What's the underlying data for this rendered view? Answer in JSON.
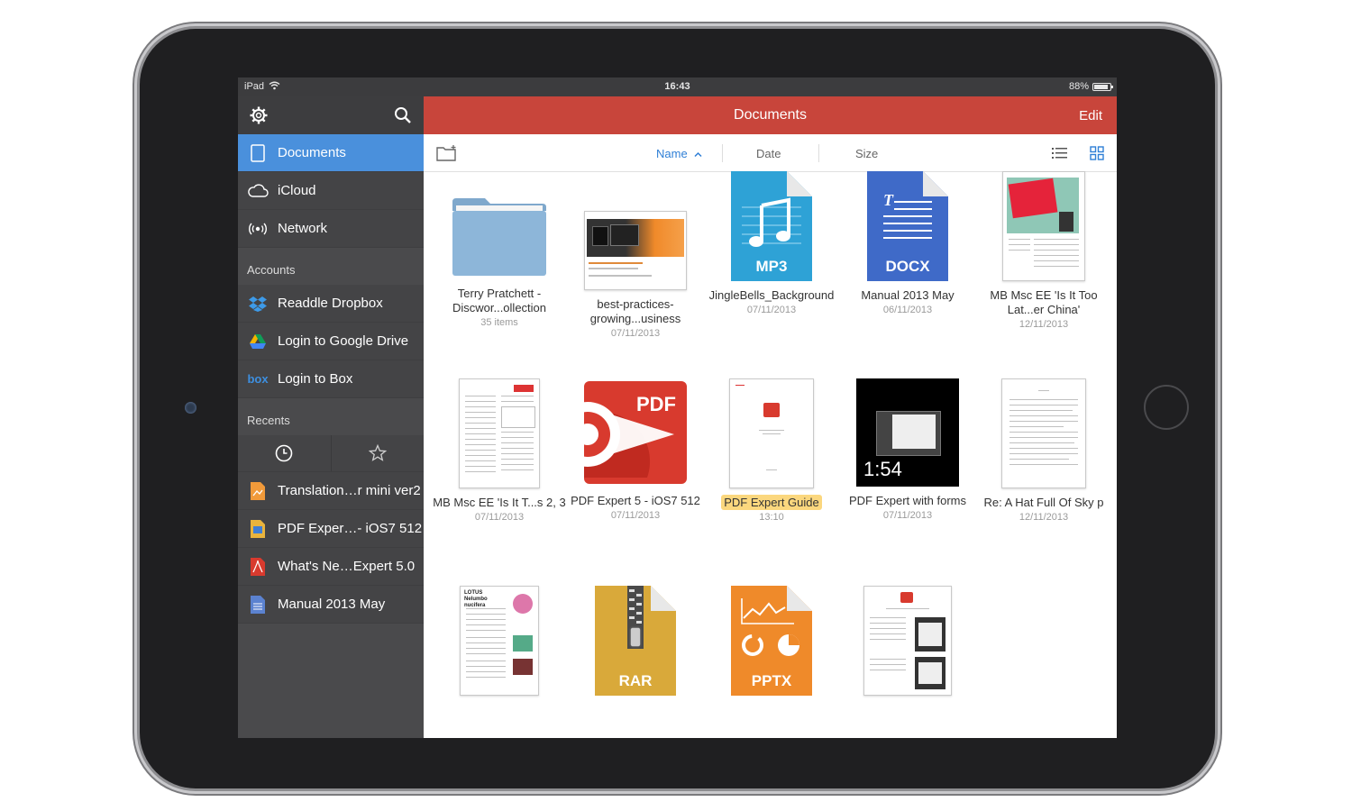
{
  "status": {
    "device": "iPad",
    "time": "16:43",
    "battery": "88%",
    "battery_level": 0.88
  },
  "sidebar": {
    "main_items": [
      {
        "label": "Documents"
      },
      {
        "label": "iCloud"
      },
      {
        "label": "Network"
      }
    ],
    "accounts_header": "Accounts",
    "accounts": [
      {
        "label": "Readdle Dropbox"
      },
      {
        "label": "Login to Google Drive"
      },
      {
        "label": "Login to Box",
        "icon_text": "box"
      }
    ],
    "recents_header": "Recents",
    "recents": [
      {
        "label": "Translation…r mini ver2"
      },
      {
        "label": "PDF Exper…- iOS7 512"
      },
      {
        "label": "What's Ne…Expert 5.0"
      },
      {
        "label": "Manual 2013 May"
      }
    ]
  },
  "navbar": {
    "title": "Documents",
    "edit": "Edit"
  },
  "sortbar": {
    "name": "Name",
    "date": "Date",
    "size": "Size"
  },
  "files": [
    {
      "name": "Terry Pratchett - Discwor...ollection",
      "meta": "35 items"
    },
    {
      "name": "best-practices-growing...usiness",
      "meta": "07/11/2013"
    },
    {
      "name": "JingleBells_Background",
      "meta": "07/11/2013",
      "type_label": "MP3"
    },
    {
      "name": "Manual 2013 May",
      "meta": "06/11/2013",
      "type_label": "DOCX"
    },
    {
      "name": "MB Msc EE 'Is It Too Lat...er China'",
      "meta": "12/11/2013"
    },
    {
      "name": "MB Msc EE 'Is It T...s 2, 3",
      "meta": "07/11/2013"
    },
    {
      "name": "PDF Expert 5 - iOS7 512",
      "meta": "07/11/2013",
      "type_label": "PDF"
    },
    {
      "name": "PDF Expert Guide",
      "meta": "13:10"
    },
    {
      "name": "PDF Expert with forms",
      "meta": "07/11/2013",
      "type_label": "1:54"
    },
    {
      "name": "Re: A Hat Full Of Sky p",
      "meta": "12/11/2013"
    },
    {
      "name": "",
      "meta": "",
      "doc_title": "LOTUS Nelumbo nucifera"
    },
    {
      "name": "",
      "meta": "",
      "type_label": "RAR"
    },
    {
      "name": "",
      "meta": "",
      "type_label": "PPTX"
    },
    {
      "name": "",
      "meta": ""
    }
  ],
  "colors": {
    "navbar": "#c8453b",
    "active_sidebar": "#4a90dc",
    "sidebar_bg": "#4a4a4c",
    "mp3": "#2ea2d6",
    "docx": "#3f6ac8",
    "pdf": "#d83a2e",
    "rar": "#d9a93a",
    "pptx": "#ef8a2a",
    "highlight": "#fbd77e"
  }
}
